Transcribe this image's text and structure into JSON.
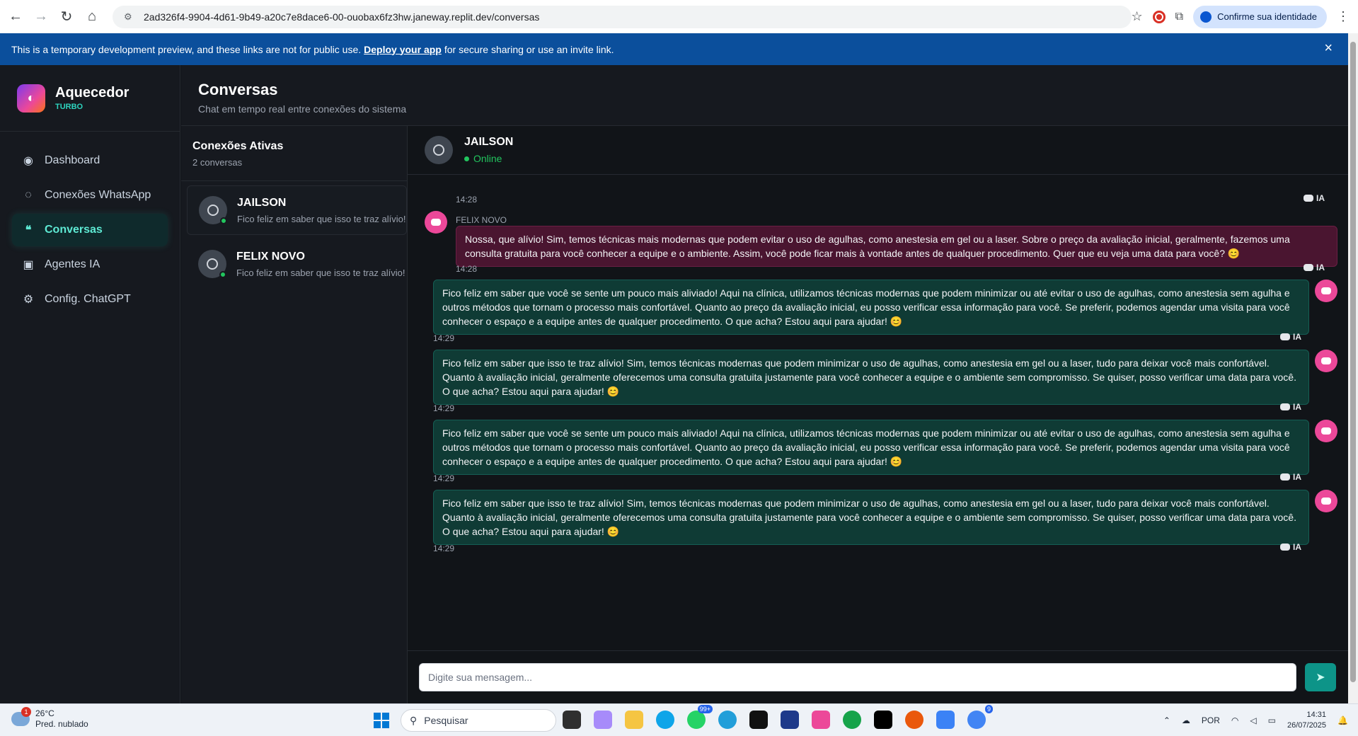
{
  "browser": {
    "url": "2ad326f4-9904-4d61-9b49-a20c7e8dace6-00-ouobax6fz3hw.janeway.replit.dev/conversas",
    "identity_label": "Confirme sua identidade"
  },
  "banner": {
    "text_before": "This is a temporary development preview, and these links are not for public use.",
    "link": "Deploy your app",
    "text_after": "for secure sharing or use an invite link.",
    "close": "×"
  },
  "brand": {
    "name": "Aquecedor",
    "tag": "TURBO"
  },
  "nav": [
    {
      "label": "Dashboard",
      "icon": "dashboard-icon",
      "glyph": "◉"
    },
    {
      "label": "Conexões WhatsApp",
      "icon": "whatsapp-icon",
      "glyph": "◌"
    },
    {
      "label": "Conversas",
      "icon": "chat-icon",
      "glyph": "❝"
    },
    {
      "label": "Agentes IA",
      "icon": "robot-icon",
      "glyph": "▣"
    },
    {
      "label": "Config. ChatGPT",
      "icon": "gear-icon",
      "glyph": "⚙"
    }
  ],
  "header": {
    "title": "Conversas",
    "subtitle": "Chat em tempo real entre conexões do sistema"
  },
  "connections": {
    "title": "Conexões Ativas",
    "count": "2 conversas",
    "items": [
      {
        "name": "JAILSON",
        "preview": "Fico feliz em saber que isso te traz alívio! Sim"
      },
      {
        "name": "FELIX NOVO",
        "preview": "Fico feliz em saber que isso te traz alívio! Sim"
      }
    ]
  },
  "chat": {
    "name": "JAILSON",
    "status": "Online",
    "ia_label": "IA",
    "first_time": "14:28",
    "incoming": {
      "sender": "FELIX NOVO",
      "text": "Nossa, que alívio! Sim, temos técnicas mais modernas que podem evitar o uso de agulhas, como anestesia em gel ou a laser. Sobre o preço da avaliação inicial, geralmente, fazemos uma consulta gratuita para você conhecer a equipe e o ambiente. Assim, você pode ficar mais à vontade antes de qualquer procedimento. Quer que eu veja uma data para você? 😊",
      "time": "14:28"
    },
    "outgoing": [
      {
        "text": "Fico feliz em saber que você se sente um pouco mais aliviado! Aqui na clínica, utilizamos técnicas modernas que podem minimizar ou até evitar o uso de agulhas, como anestesia sem agulha e outros métodos que tornam o processo mais confortável. Quanto ao preço da avaliação inicial, eu posso verificar essa informação para você. Se preferir, podemos agendar uma visita para você conhecer o espaço e a equipe antes de qualquer procedimento. O que acha? Estou aqui para ajudar! 😊",
        "time": "14:29"
      },
      {
        "text": "Fico feliz em saber que isso te traz alívio! Sim, temos técnicas modernas que podem minimizar o uso de agulhas, como anestesia em gel ou a laser, tudo para deixar você mais confortável. Quanto à avaliação inicial, geralmente oferecemos uma consulta gratuita justamente para você conhecer a equipe e o ambiente sem compromisso. Se quiser, posso verificar uma data para você. O que acha? Estou aqui para ajudar! 😊",
        "time": "14:29"
      },
      {
        "text": "Fico feliz em saber que você se sente um pouco mais aliviado! Aqui na clínica, utilizamos técnicas modernas que podem minimizar ou até evitar o uso de agulhas, como anestesia sem agulha e outros métodos que tornam o processo mais confortável. Quanto ao preço da avaliação inicial, eu posso verificar essa informação para você. Se preferir, podemos agendar uma visita para você conhecer o espaço e a equipe antes de qualquer procedimento. O que acha? Estou aqui para ajudar! 😊",
        "time": "14:29"
      },
      {
        "text": "Fico feliz em saber que isso te traz alívio! Sim, temos técnicas modernas que podem minimizar o uso de agulhas, como anestesia em gel ou a laser, tudo para deixar você mais confortável. Quanto à avaliação inicial, geralmente oferecemos uma consulta gratuita justamente para você conhecer a equipe e o ambiente sem compromisso. Se quiser, posso verificar uma data para você. O que acha? Estou aqui para ajudar! 😊",
        "time": "14:29"
      }
    ],
    "input_placeholder": "Digite sua mensagem..."
  },
  "taskbar": {
    "weather_temp": "26°C",
    "weather_desc": "Pred. nublado",
    "weather_badge": "1",
    "search": "Pesquisar",
    "whatsapp_badge": "99+",
    "chrome_badge": "9",
    "lang": "POR",
    "time": "14:31",
    "date": "26/07/2025"
  }
}
